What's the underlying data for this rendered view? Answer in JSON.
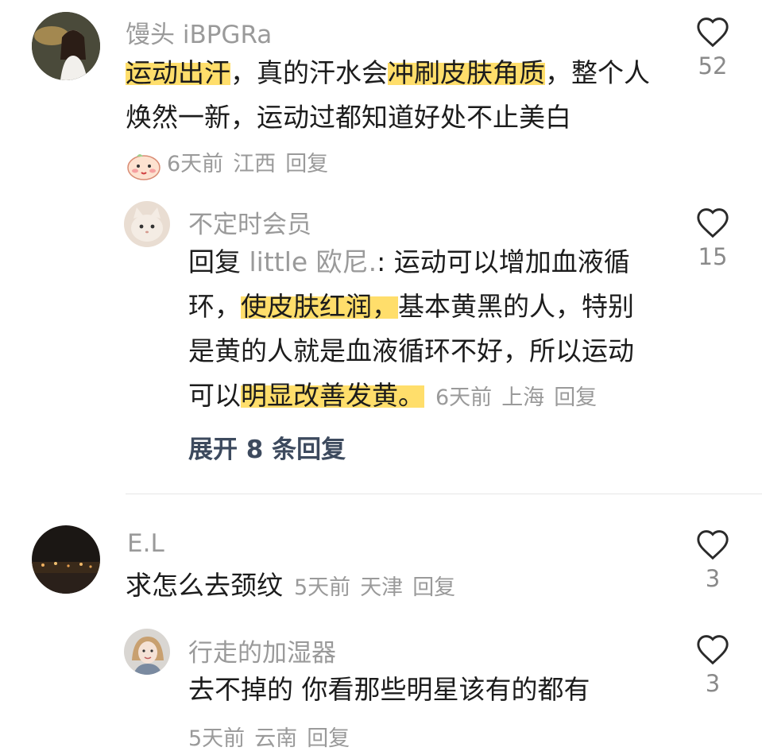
{
  "comments": [
    {
      "username": "馒头 iBPGRa",
      "content": [
        "运动出汗",
        "，真的汗水会",
        "冲刷皮肤角质",
        "，整个人焕然一新，运动过都知道好处不止美白"
      ],
      "time": "6天前",
      "location": "江西",
      "reply_label": "回复",
      "likes": "52",
      "replies": [
        {
          "username": "不定时会员",
          "reply_prefix": "回复",
          "reply_target": "little 欧尼.",
          "content": [
            ": 运动可以增加血液循环，",
            "使皮肤红润，",
            "基本黄黑的人，特别是黄的人就是血液循环不好，所以运动可以",
            "明显改善发黄。"
          ],
          "time": "6天前",
          "location": "上海",
          "reply_label": "回复",
          "likes": "15"
        }
      ],
      "expand_label": "展开 8 条回复"
    },
    {
      "username": "E.L",
      "content": "求怎么去颈纹",
      "time": "5天前",
      "location": "天津",
      "reply_label": "回复",
      "likes": "3",
      "replies": [
        {
          "username": "行走的加湿器",
          "content": "去不掉的 你看那些明星该有的都有",
          "time": "5天前",
          "location": "云南",
          "reply_label": "回复",
          "likes": "3"
        }
      ]
    }
  ],
  "colors": {
    "highlight": "#ffde6b",
    "muted": "#9a9a9a",
    "expand": "#3d4a5e"
  },
  "icons": {
    "like": "heart-outline-icon",
    "badge": "cute-face-sticker-icon"
  }
}
